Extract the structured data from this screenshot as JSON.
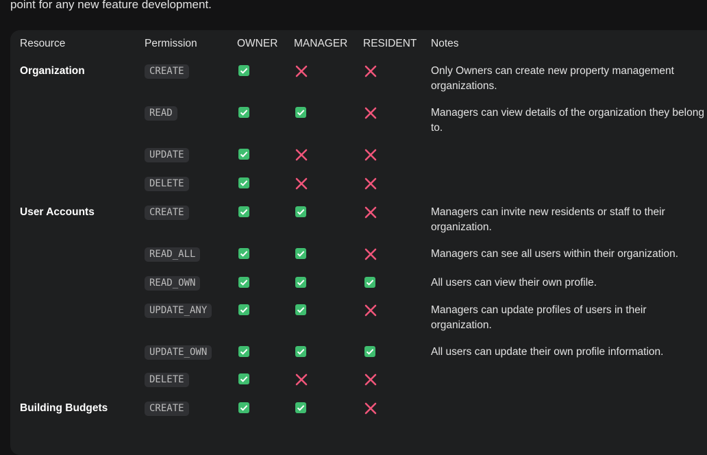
{
  "intro_text": "point for any new feature development.",
  "columns": [
    "Resource",
    "Permission",
    "OWNER",
    "MANAGER",
    "RESIDENT",
    "Notes"
  ],
  "rows": [
    {
      "resource": "Organization",
      "permission": "CREATE",
      "owner": true,
      "manager": false,
      "resident": false,
      "notes": "Only Owners can create new property management organizations."
    },
    {
      "resource": "",
      "permission": "READ",
      "owner": true,
      "manager": true,
      "resident": false,
      "notes": "Managers can view details of the organization they belong to."
    },
    {
      "resource": "",
      "permission": "UPDATE",
      "owner": true,
      "manager": false,
      "resident": false,
      "notes": ""
    },
    {
      "resource": "",
      "permission": "DELETE",
      "owner": true,
      "manager": false,
      "resident": false,
      "notes": ""
    },
    {
      "resource": "User Accounts",
      "permission": "CREATE",
      "owner": true,
      "manager": true,
      "resident": false,
      "notes": "Managers can invite new residents or staff to their organization."
    },
    {
      "resource": "",
      "permission": "READ_ALL",
      "owner": true,
      "manager": true,
      "resident": false,
      "notes": "Managers can see all users within their organization."
    },
    {
      "resource": "",
      "permission": "READ_OWN",
      "owner": true,
      "manager": true,
      "resident": true,
      "notes": "All users can view their own profile."
    },
    {
      "resource": "",
      "permission": "UPDATE_ANY",
      "owner": true,
      "manager": true,
      "resident": false,
      "notes": "Managers can update profiles of users in their organization."
    },
    {
      "resource": "",
      "permission": "UPDATE_OWN",
      "owner": true,
      "manager": true,
      "resident": true,
      "notes": "All users can update their own profile information."
    },
    {
      "resource": "",
      "permission": "DELETE",
      "owner": true,
      "manager": false,
      "resident": false,
      "notes": ""
    },
    {
      "resource": "Building Budgets",
      "permission": "CREATE",
      "owner": true,
      "manager": true,
      "resident": false,
      "notes": ""
    }
  ],
  "colors": {
    "yes": "#3fbd6f",
    "no": "#f0557a",
    "card": "#1e1f20",
    "background": "#131314"
  },
  "icons": {
    "yes": "check-box-icon",
    "no": "cross-icon"
  }
}
